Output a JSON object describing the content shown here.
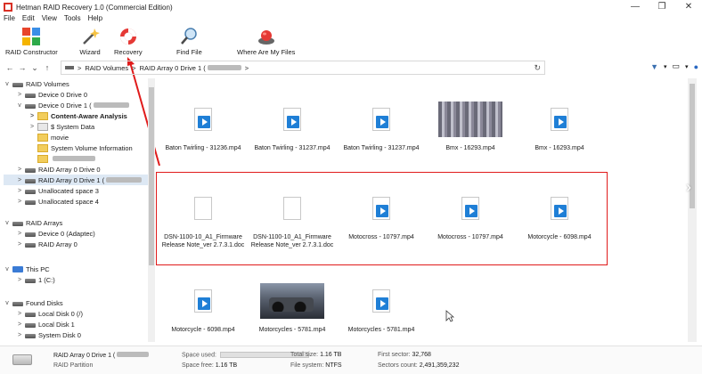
{
  "window": {
    "title": "Hetman RAID Recovery 1.0 (Commercial Edition)",
    "controls": [
      "—",
      "❐",
      "✕"
    ]
  },
  "menu": [
    "File",
    "Edit",
    "View",
    "Tools",
    "Help"
  ],
  "ribbon": [
    {
      "label": "RAID Constructor",
      "icon": "puzzle-icon"
    },
    {
      "label": "Wizard",
      "icon": "wand-icon"
    },
    {
      "label": "Recovery",
      "icon": "lifebuoy-icon"
    },
    {
      "label": "Find File",
      "icon": "magnifier-icon"
    },
    {
      "label": "Where Are My Files",
      "icon": "red-button-icon"
    }
  ],
  "address": {
    "crumbs": [
      "RAID Volumes",
      "RAID Array 0 Drive 1 ("
    ],
    "separator": ">"
  },
  "tree": [
    {
      "label": "RAID Volumes",
      "expander": "v"
    },
    {
      "label": "Device 0 Drive 0",
      "expander": ">"
    },
    {
      "label": "Device 0 Drive 1 (",
      "expander": "v"
    },
    {
      "label": "Content-Aware Analysis",
      "expander": ">"
    },
    {
      "label": "$ System Data",
      "expander": ">"
    },
    {
      "label": "movie",
      "expander": ""
    },
    {
      "label": "System Volume Information",
      "expander": ""
    },
    {
      "label": "",
      "expander": ""
    },
    {
      "label": "RAID Array 0 Drive 0",
      "expander": ">"
    },
    {
      "label": "RAID Array 0 Drive 1 (",
      "expander": ">"
    },
    {
      "label": "Unallocated space 3",
      "expander": ">"
    },
    {
      "label": "Unallocated space 4",
      "expander": ">"
    },
    {
      "label": "RAID Arrays",
      "expander": "v"
    },
    {
      "label": "Device 0 (Adaptec)",
      "expander": ">"
    },
    {
      "label": "RAID Array 0",
      "expander": ">"
    },
    {
      "label": "This PC",
      "expander": "v"
    },
    {
      "label": "1 (C:)",
      "expander": ">"
    },
    {
      "label": "Found Disks",
      "expander": "v"
    },
    {
      "label": "Local Disk 0 (/)",
      "expander": ">"
    },
    {
      "label": "Local Disk 1",
      "expander": ">"
    },
    {
      "label": "System Disk 0",
      "expander": ">"
    }
  ],
  "files": [
    {
      "name": "Baton Twirling - 31236.mp4",
      "kind": "video"
    },
    {
      "name": "Baton Twirling - 31237.mp4",
      "kind": "video"
    },
    {
      "name": "Baton Twirling - 31237.mp4",
      "kind": "video"
    },
    {
      "name": "Bmx - 16293.mp4",
      "kind": "thumb-bars"
    },
    {
      "name": "Bmx - 16293.mp4",
      "kind": "video"
    },
    {
      "name": "DSN-1100-10_A1_Firmware\nRelease Note_ver 2.7.3.1.doc",
      "kind": "doc"
    },
    {
      "name": "DSN-1100-10_A1_Firmware\nRelease Note_ver 2.7.3.1.doc",
      "kind": "doc"
    },
    {
      "name": "Motocross - 10797.mp4",
      "kind": "video"
    },
    {
      "name": "Motocross - 10797.mp4",
      "kind": "video"
    },
    {
      "name": "Motorcycle - 6098.mp4",
      "kind": "video"
    },
    {
      "name": "Motorcycle - 6098.mp4",
      "kind": "video"
    },
    {
      "name": "Motorcycles - 5781.mp4",
      "kind": "thumb-moto"
    },
    {
      "name": "Motorcycles - 5781.mp4",
      "kind": "video"
    }
  ],
  "status": {
    "drive_name": "RAID Array 0 Drive 1 (",
    "drive_type": "RAID Partition",
    "space_used_label": "Space used:",
    "space_free_label": "Space free:",
    "space_free_value": "1.16 TB",
    "total_size_label": "Total size:",
    "total_size_value": "1.16 TB",
    "file_system_label": "File system:",
    "file_system_value": "NTFS",
    "first_sector_label": "First sector:",
    "first_sector_value": "32,768",
    "sectors_count_label": "Sectors count:",
    "sectors_count_value": "2,491,359,232"
  },
  "colors": {
    "highlight": "#e01b1b",
    "selection": "#dde8f4"
  }
}
